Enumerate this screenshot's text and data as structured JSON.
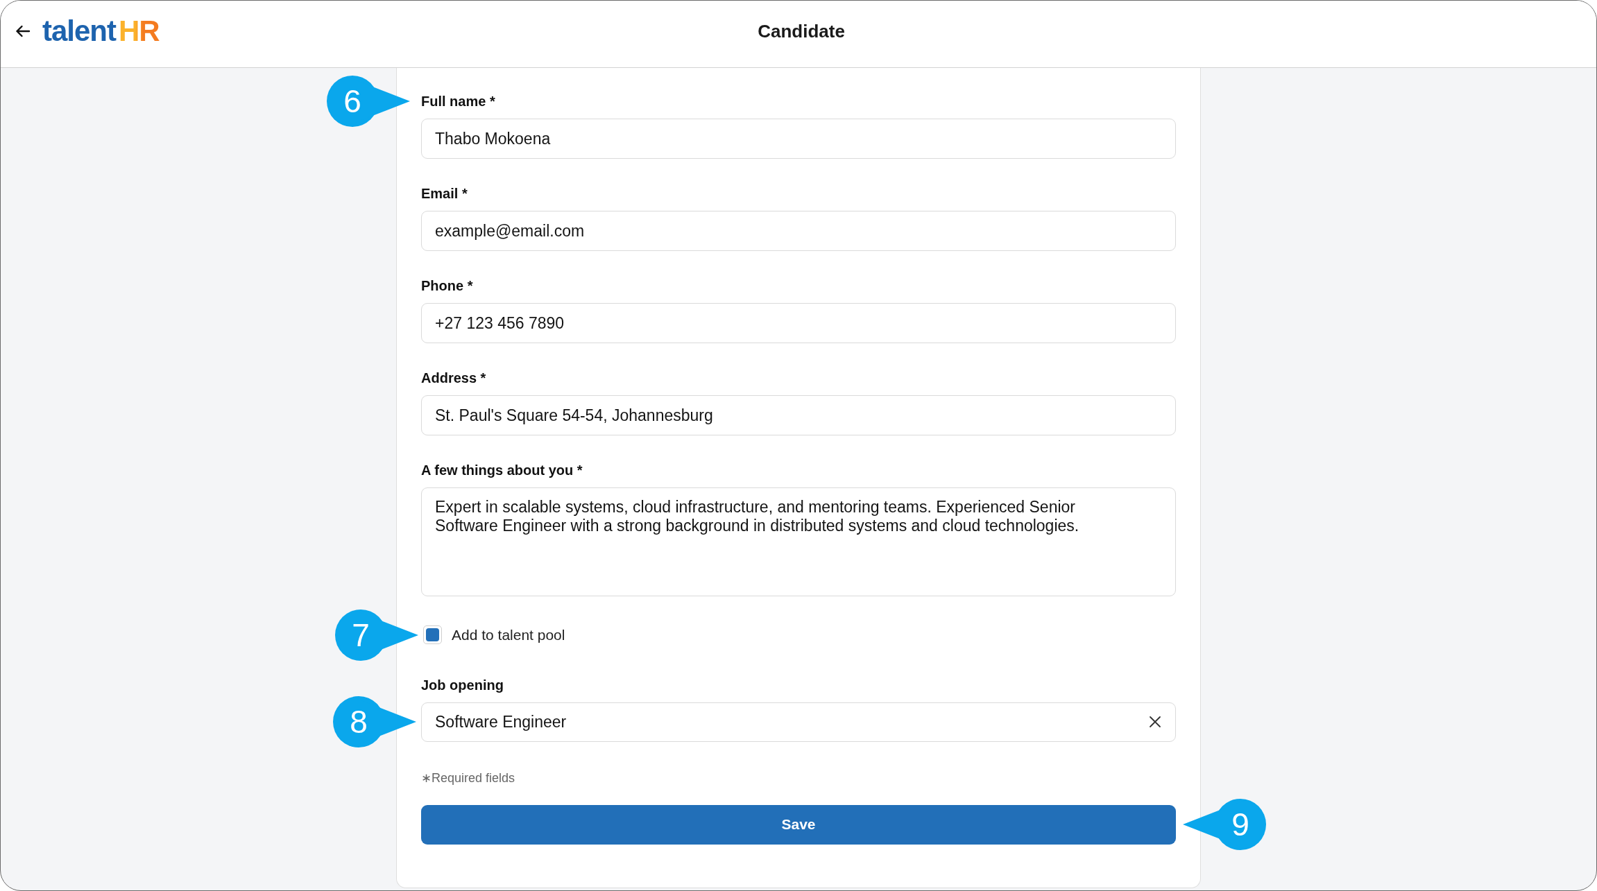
{
  "header": {
    "logo": {
      "text": "talent",
      "accent": "HR"
    },
    "title": "Candidate"
  },
  "form": {
    "fields": [
      {
        "kind": "input",
        "label": "Full name *",
        "value": "Thabo Mokoena",
        "callout": {
          "number": "6",
          "kind": "rightward"
        }
      },
      {
        "kind": "input",
        "label": "Email *",
        "value": "example@email.com"
      },
      {
        "kind": "input",
        "label": "Phone *",
        "value": "+27 123 456 7890"
      },
      {
        "kind": "input",
        "label": "Address *",
        "value": "St. Paul's Square 54-54, Johannesburg"
      },
      {
        "kind": "textarea",
        "label": "A few things about you *",
        "value": "Expert in scalable systems, cloud infrastructure, and mentoring teams. Experienced Senior Software Engineer with a strong background in distributed systems and cloud technologies."
      }
    ],
    "talent_pool": {
      "label": "Add to talent pool",
      "checked": true,
      "callout": {
        "number": "7",
        "kind": "rightward"
      }
    },
    "job_opening": {
      "label": "Job opening",
      "value": "Software Engineer",
      "clearable": true,
      "callout": {
        "number": "8",
        "kind": "rightward"
      }
    },
    "required_note": "∗Required fields",
    "save_button": {
      "label": "Save",
      "callout": {
        "number": "9",
        "kind": "leftward"
      }
    }
  }
}
